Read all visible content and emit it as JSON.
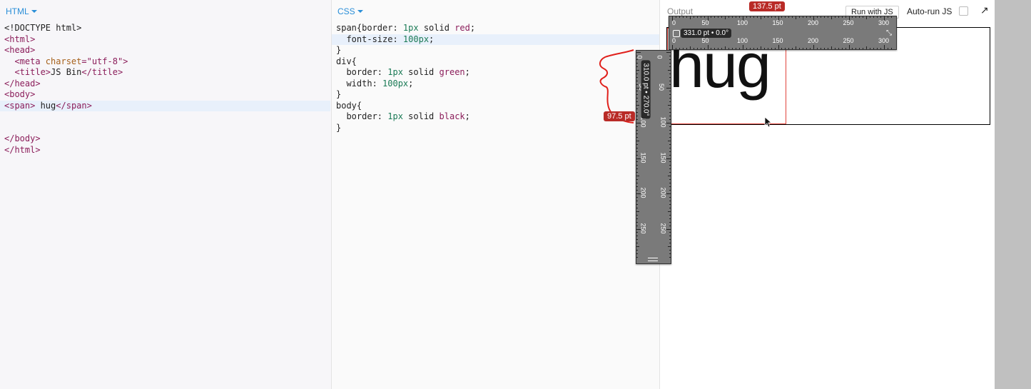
{
  "html_panel": {
    "label": "HTML",
    "lines": [
      [
        {
          "t": "<!DOCTYPE html>",
          "c": "txt"
        }
      ],
      [
        {
          "t": "<html>",
          "c": "tag"
        }
      ],
      [
        {
          "t": "<head>",
          "c": "tag"
        }
      ],
      [
        {
          "t": "  <meta ",
          "c": "tag"
        },
        {
          "t": "charset",
          "c": "attr"
        },
        {
          "t": "=\"utf-8\"",
          "c": "str"
        },
        {
          "t": ">",
          "c": "tag"
        }
      ],
      [
        {
          "t": "  <title>",
          "c": "tag"
        },
        {
          "t": "JS Bin",
          "c": "txt"
        },
        {
          "t": "</title>",
          "c": "tag"
        }
      ],
      [
        {
          "t": "</head>",
          "c": "tag"
        }
      ],
      [
        {
          "t": "<body>",
          "c": "tag"
        }
      ],
      [
        {
          "t": "<span>",
          "c": "tag"
        },
        {
          "t": " hug",
          "c": "txt"
        },
        {
          "t": "</span>",
          "c": "tag"
        }
      ],
      [],
      [],
      [
        {
          "t": "</body>",
          "c": "tag"
        }
      ],
      [
        {
          "t": "</html>",
          "c": "tag"
        }
      ]
    ],
    "active_line": 7
  },
  "css_panel": {
    "label": "CSS",
    "lines": [
      [
        {
          "t": "span{border: ",
          "c": "prop"
        },
        {
          "t": "1px",
          "c": "val"
        },
        {
          "t": " solid ",
          "c": "prop"
        },
        {
          "t": "red",
          "c": "tag"
        },
        {
          "t": ";",
          "c": "prop"
        }
      ],
      [
        {
          "t": "  font-size: ",
          "c": "prop"
        },
        {
          "t": "100px",
          "c": "val"
        },
        {
          "t": ";",
          "c": "prop"
        }
      ],
      [
        {
          "t": "}",
          "c": "prop"
        }
      ],
      [
        {
          "t": "div{",
          "c": "prop"
        }
      ],
      [
        {
          "t": "  border: ",
          "c": "prop"
        },
        {
          "t": "1px",
          "c": "val"
        },
        {
          "t": " solid ",
          "c": "prop"
        },
        {
          "t": "green",
          "c": "tag"
        },
        {
          "t": ";",
          "c": "prop"
        }
      ],
      [
        {
          "t": "  width: ",
          "c": "prop"
        },
        {
          "t": "100px",
          "c": "val"
        },
        {
          "t": ";",
          "c": "prop"
        }
      ],
      [
        {
          "t": "}",
          "c": "prop"
        }
      ],
      [
        {
          "t": "body{",
          "c": "prop"
        }
      ],
      [
        {
          "t": "  border: ",
          "c": "prop"
        },
        {
          "t": "1px",
          "c": "val"
        },
        {
          "t": " solid ",
          "c": "prop"
        },
        {
          "t": "black",
          "c": "tag"
        },
        {
          "t": ";",
          "c": "prop"
        }
      ],
      [
        {
          "t": "}",
          "c": "prop"
        }
      ]
    ],
    "active_line": 1
  },
  "output_panel": {
    "label": "Output",
    "run_button": "Run with JS",
    "autorun_label": "Auto-run JS",
    "autorun_checked": false,
    "preview_text": "hug"
  },
  "rulers": {
    "horizontal_readout": "331.0 pt • 0.0°",
    "vertical_readout": "310.0 pt • 270.0°",
    "horizontal_badge": "137.5 pt",
    "vertical_badge": "97.5 pt",
    "tick_labels": [
      "0",
      "50",
      "100",
      "150",
      "200",
      "250",
      "300"
    ]
  },
  "colors": {
    "accent": "#2b8fd8",
    "badge": "#b92b27",
    "span_border": "#e0433b"
  }
}
